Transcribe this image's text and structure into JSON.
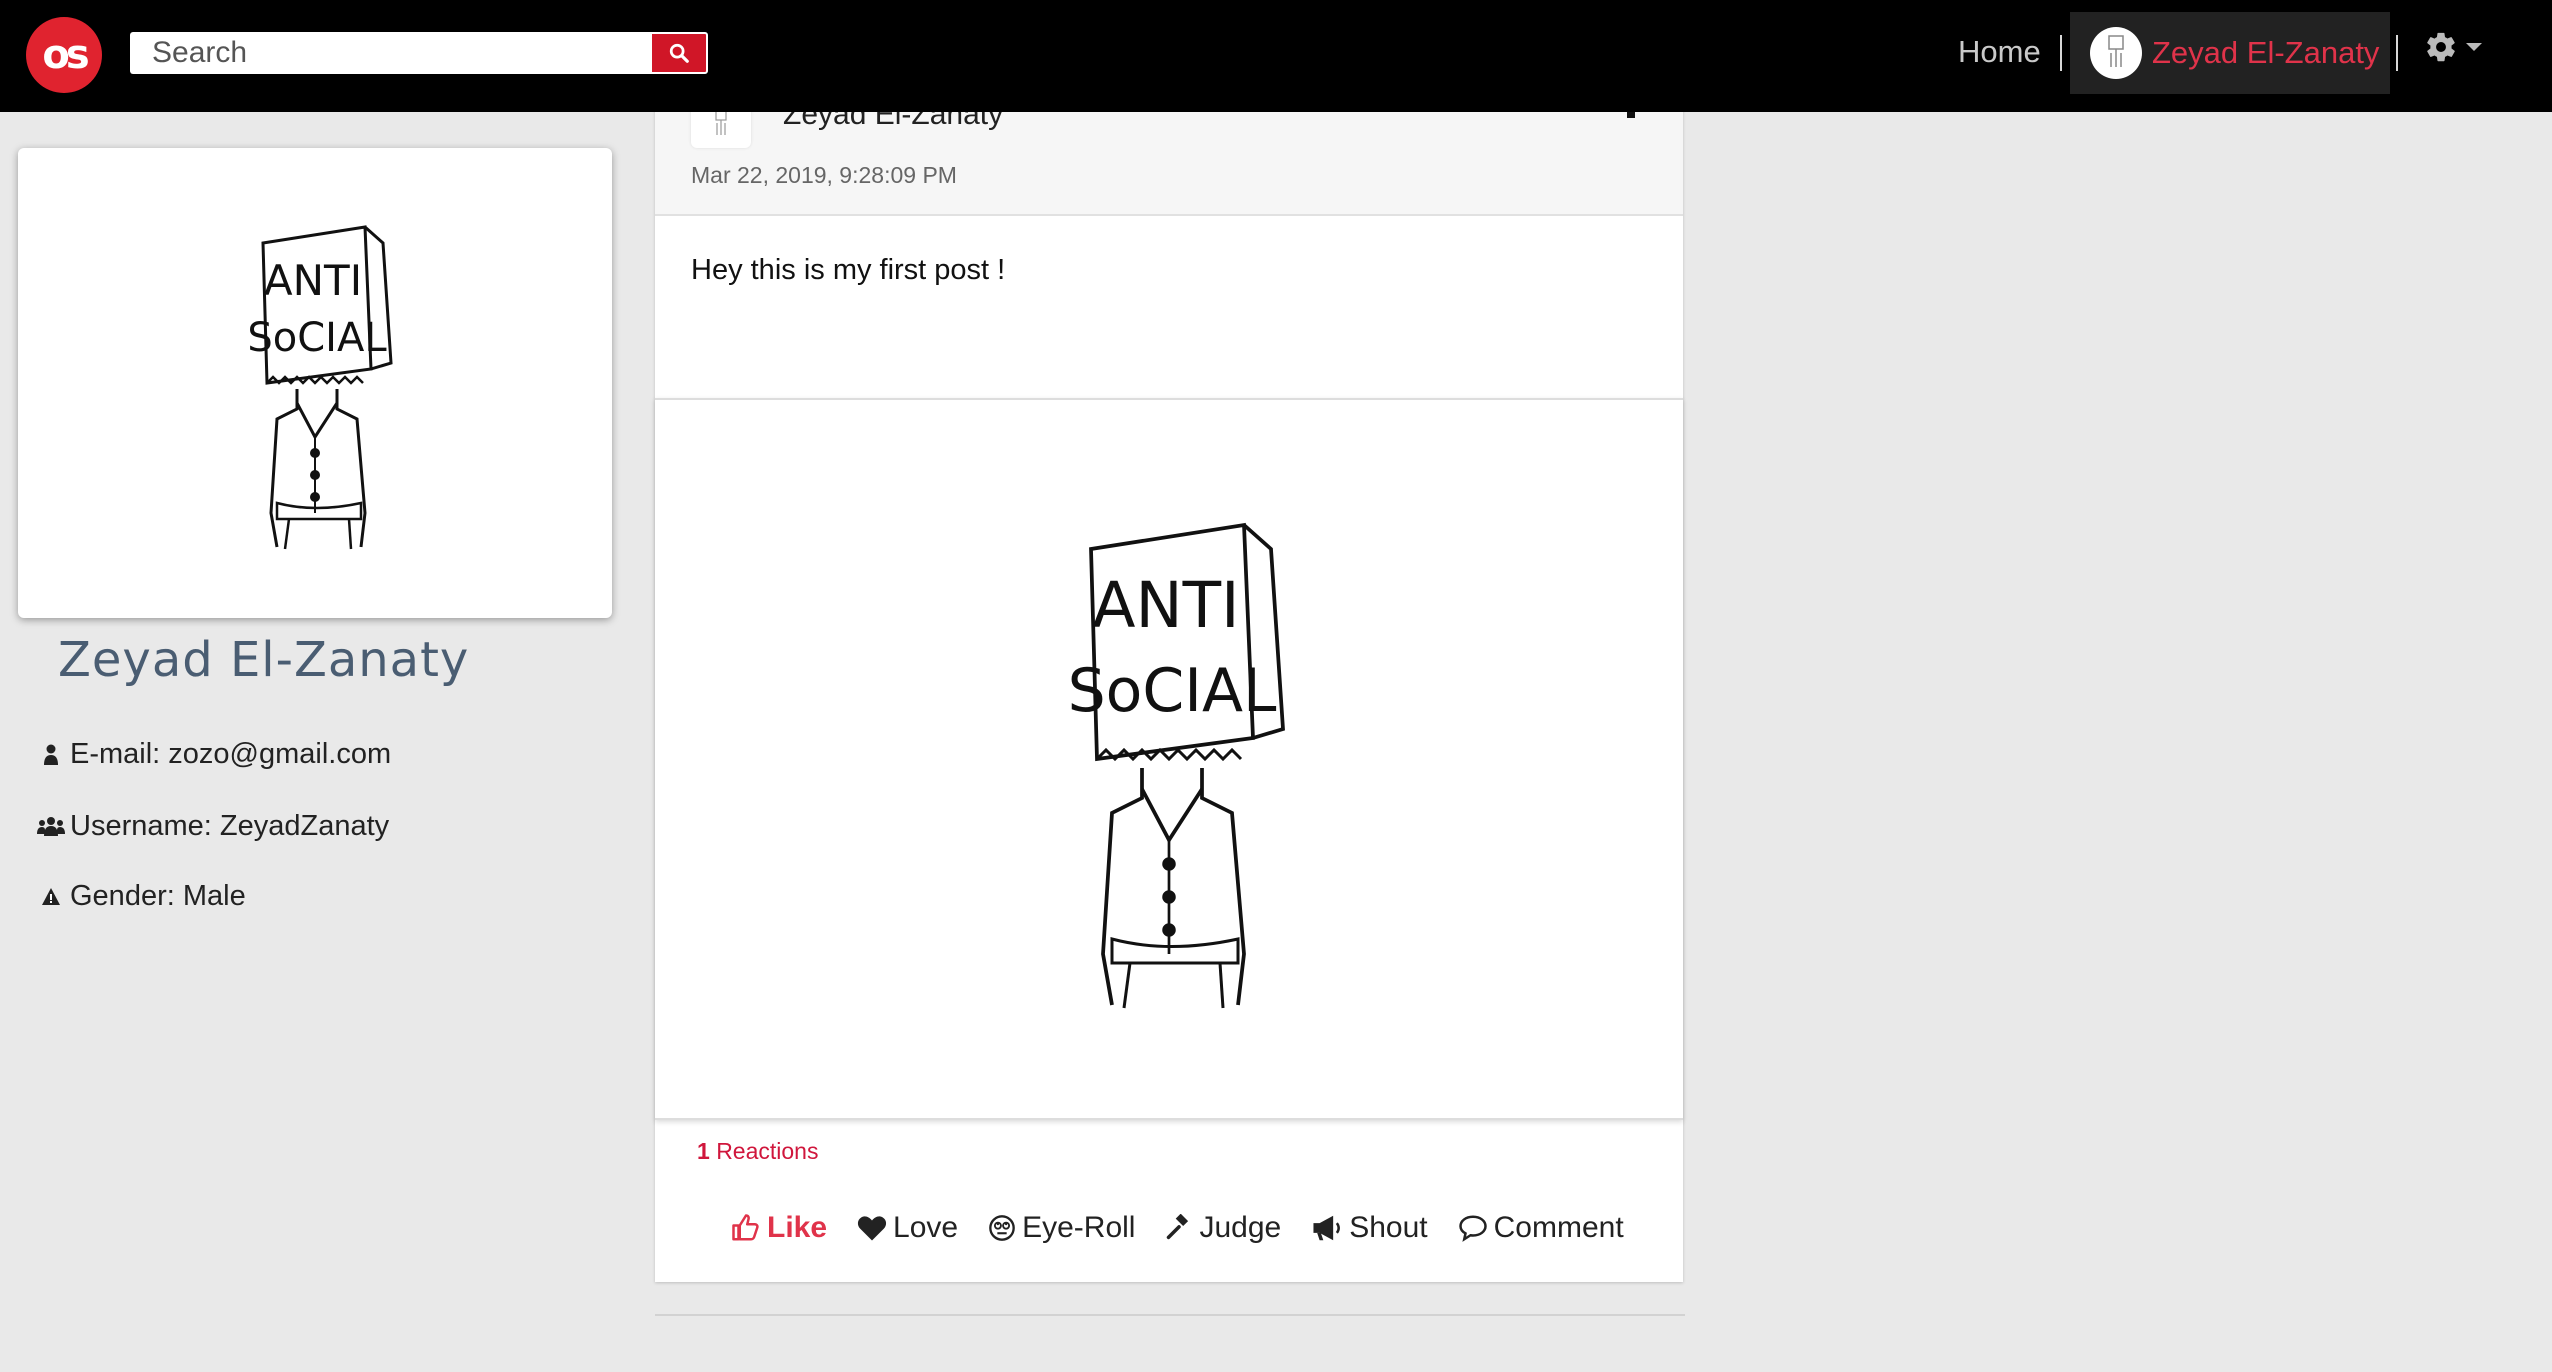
{
  "navbar": {
    "logo_text": "os",
    "search_placeholder": "Search",
    "home_label": "Home",
    "user_name": "Zeyad El-Zanaty",
    "accent_color": "#e0334a"
  },
  "profile": {
    "name": "Zeyad El-Zanaty",
    "email_label": "E-mail: zozo@gmail.com",
    "username_label": "Username: ZeyadZanaty",
    "gender_label": "Gender: Male",
    "image_text_line1": "ANTI",
    "image_text_line2": "SoCIAL"
  },
  "post": {
    "author": "Zeyad El-Zanaty",
    "date": "Mar 22, 2019, 9:28:09 PM",
    "text": "Hey this is my first post !",
    "image_text_line1": "ANTI",
    "image_text_line2": "SoCIAL",
    "reactions_count": "1",
    "reactions_label": "Reactions",
    "actions": {
      "like": "Like",
      "love": "Love",
      "eye_roll": "Eye-Roll",
      "judge": "Judge",
      "shout": "Shout",
      "comment": "Comment"
    }
  }
}
